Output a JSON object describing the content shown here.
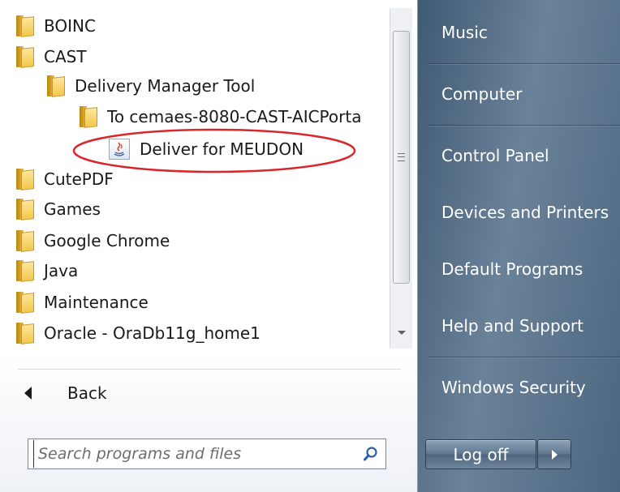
{
  "programs": [
    {
      "label": "BOINC",
      "icon": "folder-icon",
      "level": 0
    },
    {
      "label": "CAST",
      "icon": "folder-icon",
      "level": 0
    },
    {
      "label": "Delivery Manager Tool",
      "icon": "folder-icon",
      "level": 1
    },
    {
      "label": "To cemaes-8080-CAST-AICPorta",
      "icon": "folder-icon",
      "level": 2
    },
    {
      "label": "Deliver for MEUDON",
      "icon": "java-app-icon",
      "level": 3
    },
    {
      "label": "CutePDF",
      "icon": "folder-icon",
      "level": 0
    },
    {
      "label": "Games",
      "icon": "folder-icon",
      "level": 0
    },
    {
      "label": "Google Chrome",
      "icon": "folder-icon",
      "level": 0
    },
    {
      "label": "Java",
      "icon": "folder-icon",
      "level": 0
    },
    {
      "label": "Maintenance",
      "icon": "folder-icon",
      "level": 0
    },
    {
      "label": "Oracle - OraDb11g_home1",
      "icon": "folder-icon",
      "level": 0
    }
  ],
  "back_label": "Back",
  "search": {
    "placeholder": "Search programs and files",
    "value": ""
  },
  "right_menu": [
    "Music",
    "Computer",
    "Control Panel",
    "Devices and Printers",
    "Default Programs",
    "Help and Support",
    "Windows Security"
  ],
  "logoff_label": "Log off",
  "highlight_color": "#d9262b"
}
